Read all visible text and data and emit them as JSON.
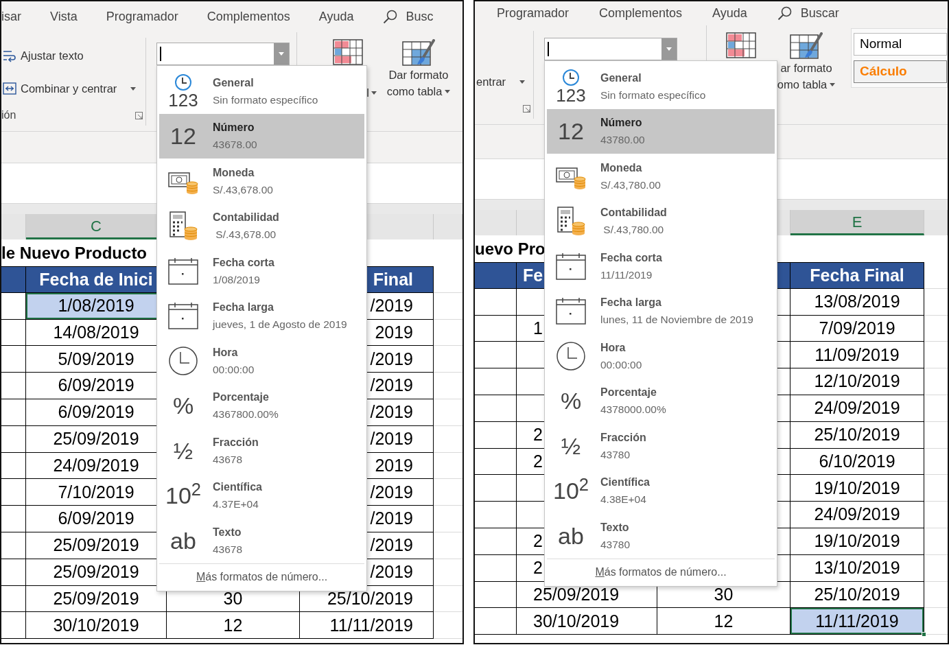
{
  "panels": [
    {
      "menu_tabs": [
        "isar",
        "Vista",
        "Programador",
        "Complementos",
        "Ayuda"
      ],
      "search": "Busc",
      "alignment_group": {
        "commands": [
          {
            "kind": "wrap",
            "label": "Ajustar texto",
            "dropdown": false
          },
          {
            "kind": "merge",
            "label": "Combinar y centrar",
            "dropdown": true
          }
        ],
        "group_label": "ión"
      },
      "styles_group": {
        "buttons": [
          {
            "kind": "conditional",
            "label": "l"
          },
          {
            "kind": "table",
            "lines": [
              "Dar formato",
              "como tabla"
            ]
          }
        ]
      },
      "sheet": {
        "column_header": {
          "label": "C",
          "selected": true
        },
        "title": "le Nuevo Producto",
        "header_cells": [
          null,
          "Fecha de Inici",
          null,
          "Final"
        ],
        "rows": [
          {
            "cells": [
              null,
              "1/08/2019",
              null,
              "/2019"
            ],
            "selected": true
          },
          {
            "cells": [
              null,
              "14/08/2019",
              null,
              "2019"
            ],
            "selected": false
          },
          {
            "cells": [
              null,
              "5/09/2019",
              null,
              "/2019"
            ],
            "selected": false
          },
          {
            "cells": [
              null,
              "6/09/2019",
              null,
              "/2019"
            ],
            "selected": false
          },
          {
            "cells": [
              null,
              "6/09/2019",
              null,
              "/2019"
            ],
            "selected": false
          },
          {
            "cells": [
              null,
              "25/09/2019",
              null,
              "/2019"
            ],
            "selected": false
          },
          {
            "cells": [
              null,
              "24/09/2019",
              null,
              "2019"
            ],
            "selected": false
          },
          {
            "cells": [
              null,
              "7/10/2019",
              null,
              "/2019"
            ],
            "selected": false
          },
          {
            "cells": [
              null,
              "6/09/2019",
              null,
              "/2019"
            ],
            "selected": false
          },
          {
            "cells": [
              null,
              "25/09/2019",
              null,
              "/2019"
            ],
            "selected": false
          },
          {
            "cells": [
              null,
              "25/09/2019",
              null,
              "/2019"
            ],
            "selected": false
          },
          {
            "cells": [
              null,
              "25/09/2019",
              "30",
              "25/10/2019"
            ],
            "selected": false
          },
          {
            "cells": [
              null,
              "30/10/2019",
              "12",
              "11/11/2019"
            ],
            "selected": false
          }
        ]
      },
      "format_menu": {
        "items": [
          {
            "kind": "general",
            "glyph": "123",
            "title": "General",
            "sample": "Sin formato específico",
            "selected": false
          },
          {
            "kind": "glyph",
            "glyph": "12",
            "title": "Número",
            "sample": "43678.00",
            "selected": true
          },
          {
            "kind": "currency",
            "title": "Moneda",
            "sample": "S/.43,678.00",
            "selected": false
          },
          {
            "kind": "accounting",
            "title": "Contabilidad",
            "sample": " S/.43,678.00",
            "selected": false
          },
          {
            "kind": "date",
            "title": "Fecha corta",
            "sample": "1/08/2019",
            "selected": false
          },
          {
            "kind": "date",
            "title": "Fecha larga",
            "sample": "jueves, 1 de Agosto de 2019",
            "selected": false
          },
          {
            "kind": "time",
            "title": "Hora",
            "sample": "00:00:00",
            "selected": false
          },
          {
            "kind": "glyph",
            "glyph": "%",
            "title": "Porcentaje",
            "sample": "4367800.00%",
            "selected": false
          },
          {
            "kind": "glyph",
            "glyph": "½",
            "title": "Fracción",
            "sample": "43678",
            "selected": false
          },
          {
            "kind": "glyph",
            "glyph": "10$^{2}$",
            "title": "Científica",
            "sample": "4.37E+04",
            "selected": false
          },
          {
            "kind": "glyph",
            "glyph": "ab",
            "title": "Texto",
            "sample": "43678",
            "selected": false
          }
        ],
        "more": "Más formatos de número..."
      }
    },
    {
      "menu_tabs": [
        "Programador",
        "Complementos",
        "Ayuda"
      ],
      "search": "Buscar",
      "alignment_group": {
        "commands": [
          {
            "kind": "plain",
            "label": "entrar",
            "dropdown": true
          }
        ]
      },
      "styles_group": {
        "buttons": [
          {
            "kind": "conditional"
          },
          {
            "kind": "table",
            "lines": [
              "ar formato",
              "omo tabla"
            ]
          }
        ],
        "cell_styles": [
          {
            "kind": "normal",
            "label": "Normal"
          },
          {
            "kind": "calc",
            "label": "Cálculo"
          }
        ]
      },
      "sheet": {
        "column_header": {
          "label": "E",
          "selected": true
        },
        "title": "uevo Pro",
        "header_cells": [
          null,
          "Fe",
          null,
          "Fecha Final"
        ],
        "rows": [
          {
            "cells": [
              null,
              null,
              null,
              "13/08/2019"
            ],
            "selected": false
          },
          {
            "cells": [
              null,
              "1",
              null,
              "7/09/2019"
            ],
            "selected": false
          },
          {
            "cells": [
              null,
              null,
              null,
              "11/09/2019"
            ],
            "selected": false
          },
          {
            "cells": [
              null,
              null,
              null,
              "12/10/2019"
            ],
            "selected": false
          },
          {
            "cells": [
              null,
              null,
              null,
              "24/09/2019"
            ],
            "selected": false
          },
          {
            "cells": [
              null,
              "2",
              null,
              "25/10/2019"
            ],
            "selected": false
          },
          {
            "cells": [
              null,
              "2",
              null,
              "6/10/2019"
            ],
            "selected": false
          },
          {
            "cells": [
              null,
              null,
              null,
              "19/10/2019"
            ],
            "selected": false
          },
          {
            "cells": [
              null,
              null,
              null,
              "24/09/2019"
            ],
            "selected": false
          },
          {
            "cells": [
              null,
              "2",
              null,
              "19/10/2019"
            ],
            "selected": false
          },
          {
            "cells": [
              null,
              "2",
              null,
              "13/10/2019"
            ],
            "selected": false
          },
          {
            "cells": [
              null,
              "25/09/2019",
              "30",
              "25/10/2019"
            ],
            "selected": false
          },
          {
            "cells": [
              null,
              "30/10/2019",
              "12",
              "11/11/2019"
            ],
            "selected": true
          }
        ]
      },
      "format_menu": {
        "items": [
          {
            "kind": "general",
            "glyph": "123",
            "title": "General",
            "sample": "Sin formato específico",
            "selected": false
          },
          {
            "kind": "glyph",
            "glyph": "12",
            "title": "Número",
            "sample": "43780.00",
            "selected": true
          },
          {
            "kind": "currency",
            "title": "Moneda",
            "sample": "S/.43,780.00",
            "selected": false
          },
          {
            "kind": "accounting",
            "title": "Contabilidad",
            "sample": " S/.43,780.00",
            "selected": false
          },
          {
            "kind": "date",
            "title": "Fecha corta",
            "sample": "11/11/2019",
            "selected": false
          },
          {
            "kind": "date",
            "title": "Fecha larga",
            "sample": "lunes, 11 de Noviembre de 2019",
            "selected": false
          },
          {
            "kind": "time",
            "title": "Hora",
            "sample": "00:00:00",
            "selected": false
          },
          {
            "kind": "glyph",
            "glyph": "%",
            "title": "Porcentaje",
            "sample": "4378000.00%",
            "selected": false
          },
          {
            "kind": "glyph",
            "glyph": "½",
            "title": "Fracción",
            "sample": "43780",
            "selected": false
          },
          {
            "kind": "glyph",
            "glyph": "10$^{2}$",
            "title": "Científica",
            "sample": "4.38E+04",
            "selected": false
          },
          {
            "kind": "glyph",
            "glyph": "ab",
            "title": "Texto",
            "sample": "43780",
            "selected": false
          }
        ],
        "more": "Más formatos de número..."
      }
    }
  ]
}
